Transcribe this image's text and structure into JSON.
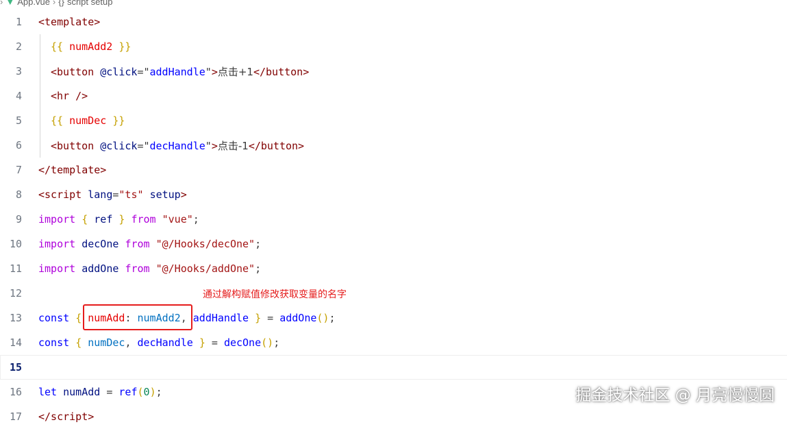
{
  "breadcrumb": {
    "file": "App.vue",
    "scope_icon": "{}",
    "scope": "script setup"
  },
  "editor": {
    "current_line": "15",
    "lines": [
      {
        "no": "1"
      },
      {
        "no": "2"
      },
      {
        "no": "3"
      },
      {
        "no": "4"
      },
      {
        "no": "5"
      },
      {
        "no": "6"
      },
      {
        "no": "7"
      },
      {
        "no": "8"
      },
      {
        "no": "9"
      },
      {
        "no": "10"
      },
      {
        "no": "11"
      },
      {
        "no": "12"
      },
      {
        "no": "13"
      },
      {
        "no": "14"
      },
      {
        "no": "15"
      },
      {
        "no": "16"
      },
      {
        "no": "17"
      }
    ],
    "tokens": {
      "template_open": "<template>",
      "interp_open": "{{",
      "interp_close": "}}",
      "numAdd2": "numAdd2",
      "numDec": "numDec",
      "button_open": "<button",
      "click_attr": "@click",
      "eq_quote": "=\"",
      "quote_close": "\"",
      "gt": ">",
      "addHandle": "addHandle",
      "decHandle": "decHandle",
      "btn_text_add": "点击+1",
      "btn_text_dec": "点击-1",
      "button_close": "</button>",
      "hr": "<hr />",
      "template_close": "</template>",
      "script_open": "<script",
      "lang_attr": "lang",
      "ts_val": "\"ts\"",
      "setup_attr": "setup",
      "import": "import",
      "from": "from",
      "ref": "ref",
      "vue_str": "\"vue\"",
      "decOne": "decOne",
      "addOne": "addOne",
      "decOne_path": "\"@/Hooks/decOne\"",
      "addOne_path": "\"@/Hooks/addOne\"",
      "const": "const",
      "let": "let",
      "numAdd": "numAdd",
      "zero": "0",
      "script_close": "</script"
    },
    "annotation": "通过解构赋值修改获取变量的名字"
  },
  "watermark": "掘金技术社区 @ 月亮慢慢圆",
  "colors": {
    "annotation_red": "#e51c1c",
    "tag": "#800000",
    "keyword_control": "#af00db",
    "keyword": "#0000ff",
    "string": "#a31515",
    "function": "#795e26"
  }
}
